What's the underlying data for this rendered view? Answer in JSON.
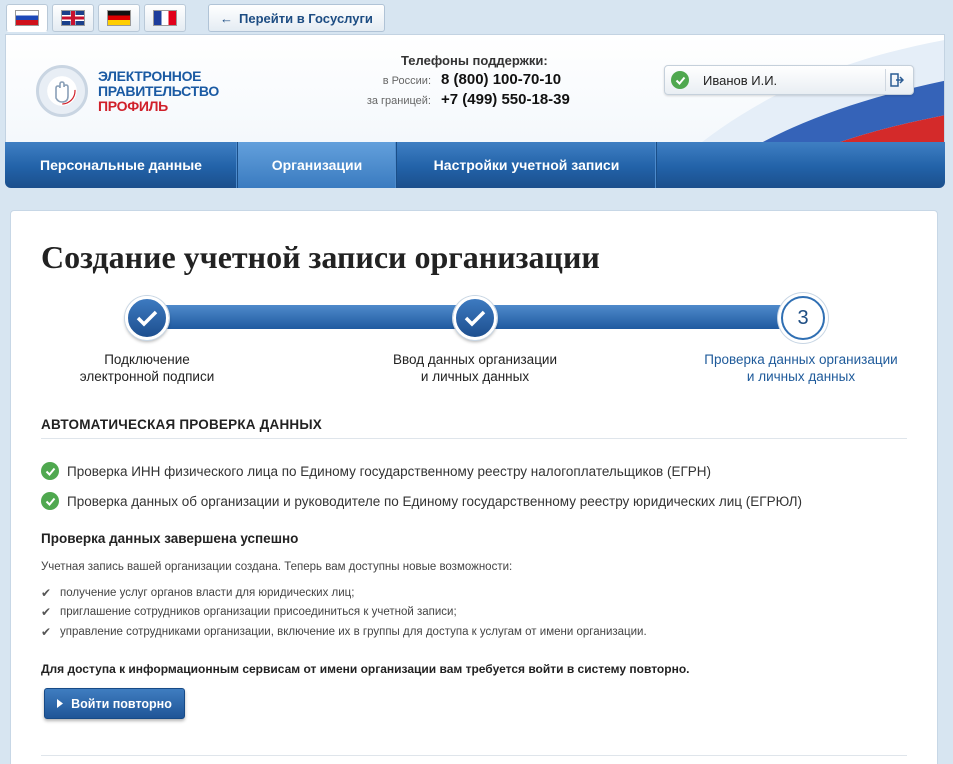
{
  "languages": [
    {
      "code": "ru",
      "icon": "russia-flag-icon",
      "active": true
    },
    {
      "code": "en",
      "icon": "uk-flag-icon",
      "active": false
    },
    {
      "code": "de",
      "icon": "germany-flag-icon",
      "active": false
    },
    {
      "code": "fr",
      "icon": "france-flag-icon",
      "active": false
    }
  ],
  "top_link": {
    "label": "Перейти в Госуслуги",
    "icon": "arrow-left-icon"
  },
  "logo": {
    "line1": "ЭЛЕКТРОННОЕ",
    "line2": "ПРАВИТЕЛЬСТВО",
    "line3": "ПРОФИЛЬ",
    "icon": "hand-emblem-icon"
  },
  "support": {
    "title": "Телефоны поддержки:",
    "russia_label": "в России:",
    "russia_phone": "8 (800) 100-70-10",
    "abroad_label": "за границей:",
    "abroad_phone": "+7 (499) 550-18-39"
  },
  "user": {
    "name": "Иванов И.И.",
    "status_icon": "check-icon",
    "logout_icon": "logout-icon"
  },
  "nav": {
    "items": [
      {
        "label": "Персональные данные",
        "active": false
      },
      {
        "label": "Организации",
        "active": true
      },
      {
        "label": "Настройки учетной записи",
        "active": false
      }
    ]
  },
  "page": {
    "title": "Создание учетной записи организации",
    "steps": [
      {
        "line1": "Подключение",
        "line2": "электронной подписи",
        "state": "done"
      },
      {
        "line1": "Ввод данных организации",
        "line2": "и личных данных",
        "state": "done"
      },
      {
        "line1": "Проверка данных организации",
        "line2": "и личных данных",
        "state": "current",
        "number": "3"
      }
    ],
    "section_title": "АВТОМАТИЧЕСКАЯ ПРОВЕРКА ДАННЫХ",
    "checks": [
      "Проверка ИНН физического лица по Единому государственному реестру налогоплательщиков (ЕГРН)",
      "Проверка данных об организации и руководителе по Единому государственному реестру юридических лиц (ЕГРЮЛ)"
    ],
    "success_title": "Проверка данных завершена успешно",
    "info_text": "Учетная запись вашей организации создана. Теперь вам доступны новые возможности:",
    "features": [
      "получение услуг органов власти для юридических лиц;",
      "приглашение сотрудников организации присоединиться к учетной записи;",
      "управление сотрудниками организации, включение их в группы для доступа к услугам от имени организации."
    ],
    "access_note": "Для доступа к информационным сервисам от имени организации вам требуется войти в систему повторно.",
    "relogin_button": "Войти повторно"
  },
  "colors": {
    "accent": "#2262a8",
    "success": "#4fa84f",
    "brand_red": "#d0202a"
  }
}
